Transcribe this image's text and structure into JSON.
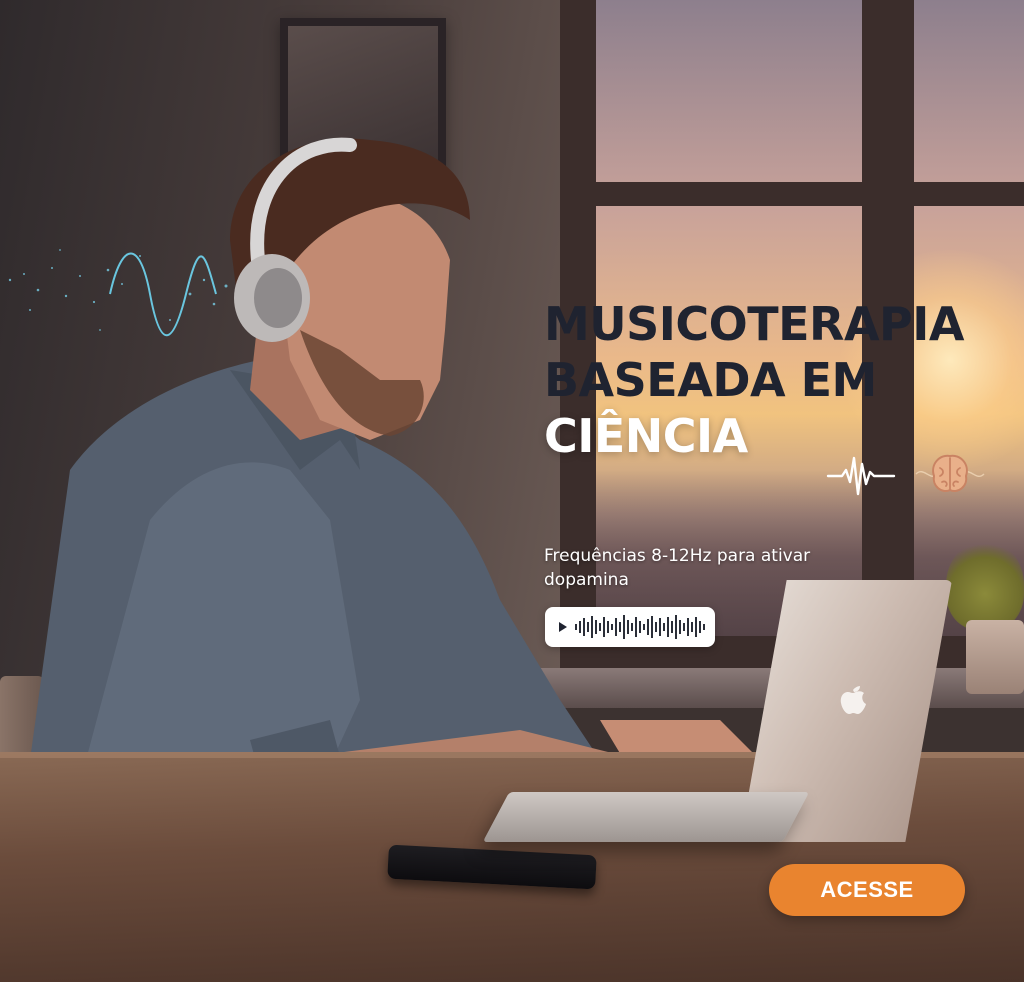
{
  "headline": {
    "line1": "MUSICOTERAPIA",
    "line2": "BASEADA EM",
    "line3": "CIÊNCIA"
  },
  "subtitle": "Frequências 8-12Hz para ativar dopamina",
  "player": {
    "icon": "play-icon"
  },
  "cta": {
    "label": "ACESSE"
  },
  "icons": [
    "heartbeat-icon",
    "brain-icon",
    "soundwave-icon",
    "play-icon"
  ],
  "colors": {
    "accent": "#e9842f",
    "headline_dark": "#1f2330",
    "headline_light": "#ffffff"
  }
}
